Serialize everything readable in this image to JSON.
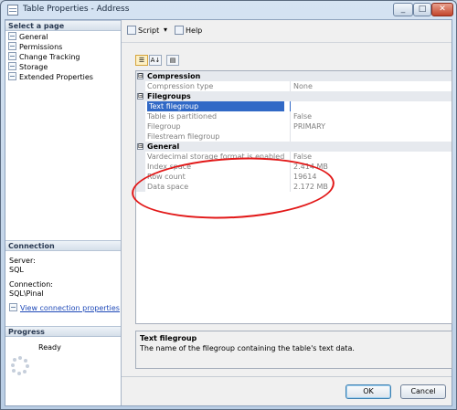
{
  "window": {
    "title": "Table Properties - Address"
  },
  "title_buttons": {
    "minimize": "_",
    "maximize": "□",
    "close": "✕"
  },
  "left": {
    "select_header": "Select a page",
    "pages": [
      "General",
      "Permissions",
      "Change Tracking",
      "Storage",
      "Extended Properties"
    ],
    "connection_header": "Connection",
    "server_label": "Server:",
    "server_value": "SQL",
    "connection_label": "Connection:",
    "connection_value": "SQL\\Pinal",
    "view_link": "View connection properties",
    "progress_header": "Progress",
    "progress_status": "Ready"
  },
  "toolbar": {
    "script_label": "Script",
    "help_label": "Help"
  },
  "grid": {
    "categorized_button": "☰",
    "alphabetical_button": "A↓",
    "pages_button": "▤",
    "rows": [
      {
        "type": "category",
        "name": "Compression",
        "expander": "⊟"
      },
      {
        "type": "prop",
        "name": "Compression type",
        "value": "None"
      },
      {
        "type": "category",
        "name": "Filegroups",
        "expander": "⊟"
      },
      {
        "type": "prop",
        "name": "Text filegroup",
        "value": "",
        "selected": true
      },
      {
        "type": "prop",
        "name": "Table is partitioned",
        "value": "False"
      },
      {
        "type": "prop",
        "name": "Filegroup",
        "value": "PRIMARY"
      },
      {
        "type": "prop",
        "name": "Filestream filegroup",
        "value": ""
      },
      {
        "type": "category",
        "name": "General",
        "expander": "⊟"
      },
      {
        "type": "prop",
        "name": "Vardecimal storage format is enabled",
        "value": "False"
      },
      {
        "type": "prop",
        "name": "Index space",
        "value": "2.414 MB"
      },
      {
        "type": "prop",
        "name": "Row count",
        "value": "19614"
      },
      {
        "type": "prop",
        "name": "Data space",
        "value": "2.172 MB"
      }
    ]
  },
  "description": {
    "title": "Text filegroup",
    "text": "The name of the filegroup containing the table's text data."
  },
  "buttons": {
    "ok": "OK",
    "cancel": "Cancel"
  },
  "colors": {
    "selection": "#3169c6",
    "annotation": "#e21818",
    "link": "#1f4ab8"
  }
}
